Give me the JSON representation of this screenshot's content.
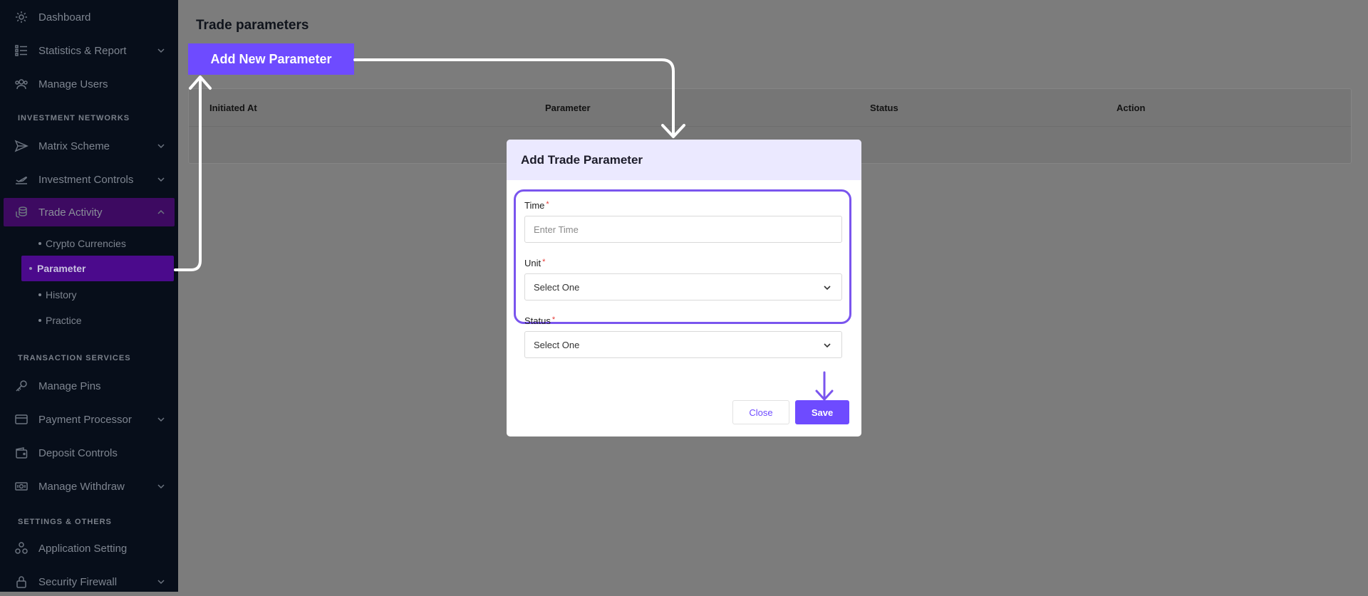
{
  "sidebar": {
    "items": [
      {
        "label": "Dashboard",
        "icon": "gear-icon"
      },
      {
        "label": "Statistics & Report",
        "icon": "list-icon",
        "chevron": true
      },
      {
        "label": "Manage Users",
        "icon": "users-icon"
      },
      {
        "label": "Matrix Scheme",
        "icon": "send-icon",
        "chevron": true
      },
      {
        "label": "Investment Controls",
        "icon": "plane-icon",
        "chevron": true
      },
      {
        "label": "Trade Activity",
        "icon": "coins-icon",
        "chevron": true,
        "expanded": true
      },
      {
        "label": "Manage Pins",
        "icon": "key-icon"
      },
      {
        "label": "Payment Processor",
        "icon": "card-icon",
        "chevron": true
      },
      {
        "label": "Deposit Controls",
        "icon": "wallet-icon"
      },
      {
        "label": "Manage Withdraw",
        "icon": "cash-icon",
        "chevron": true
      },
      {
        "label": "Application Setting",
        "icon": "apps-icon"
      },
      {
        "label": "Security Firewall",
        "icon": "lock-icon",
        "chevron": true
      }
    ],
    "sections": [
      "INVESTMENT NETWORKS",
      "TRANSACTION SERVICES",
      "SETTINGS & OTHERS"
    ],
    "trade_sub_items": [
      "Crypto Currencies",
      "Parameter",
      "History",
      "Practice"
    ]
  },
  "main": {
    "title": "Trade parameters",
    "add_button": "Add New Parameter",
    "table_headers": [
      "Initiated At",
      "Parameter",
      "Status",
      "Action"
    ]
  },
  "modal": {
    "title": "Add Trade Parameter",
    "time_label": "Time",
    "time_placeholder": "Enter Time",
    "unit_label": "Unit",
    "unit_value": "Select One",
    "status_label": "Status",
    "status_value": "Select One",
    "required_mark": "*",
    "close_label": "Close",
    "save_label": "Save"
  },
  "colors": {
    "accent": "#6e4bff",
    "sidebar_bg": "#070e1a",
    "active_item_bg": "#3d0a61",
    "active_sub_bg": "#4b0a8c",
    "highlight_border": "#7a55ee"
  }
}
